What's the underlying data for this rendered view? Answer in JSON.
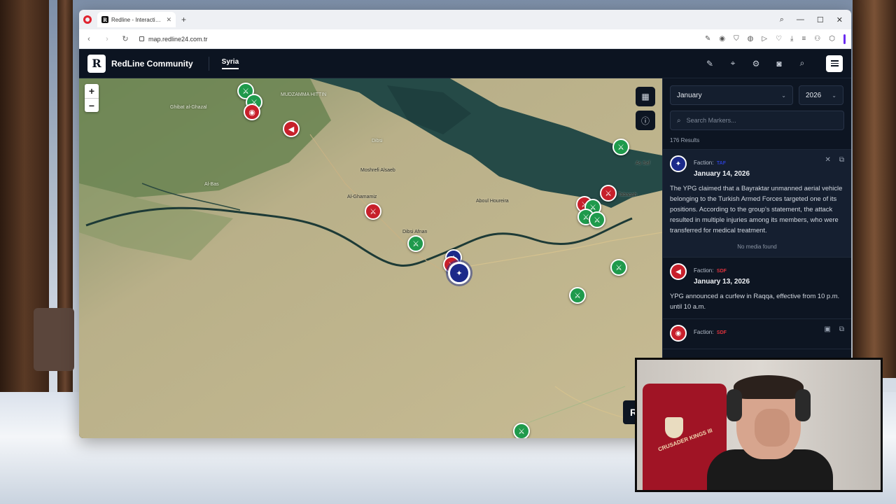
{
  "browser": {
    "tab_title": "Redline - Interactive Strat",
    "tab_favicon": "R",
    "url": "map.redline24.com.tr"
  },
  "app": {
    "logo_letter": "R",
    "title": "RedLine Community",
    "region_tab": "Syria",
    "header_icons": [
      "pen-icon",
      "location-pin-icon",
      "gear-icon",
      "camera-icon",
      "search-icon",
      "menu-icon"
    ]
  },
  "map": {
    "zoom_in": "+",
    "zoom_out": "−",
    "labels": [
      {
        "text": "Dibsi"
      },
      {
        "text": "Moshrefi Alsaeb"
      },
      {
        "text": "Al-Ghamamiz"
      },
      {
        "text": "Dibsi Afnan"
      },
      {
        "text": "Aboul Houreira"
      },
      {
        "text": "Al-Bas"
      },
      {
        "text": "Ghibat al-Ghazal"
      },
      {
        "text": "MUDZAMMA HITTIN"
      },
      {
        "text": "Tabaqah"
      },
      {
        "text": "As Saf"
      }
    ],
    "badge_letter": "R"
  },
  "panel": {
    "month": "January",
    "year": "2026",
    "search_placeholder": "Search Markers...",
    "results_count": "176 Results",
    "entries": [
      {
        "faction_label": "Faction:",
        "faction": "TAF",
        "date": "January 14, 2026",
        "body": "The YPG claimed that a Bayraktar unmanned aerial vehicle belonging to the Turkish Armed Forces targeted one of its positions. According to the group's statement, the attack resulted in multiple injuries among its members, who were transferred for medical treatment.",
        "media": "No media found"
      },
      {
        "faction_label": "Faction:",
        "faction": "SDF",
        "date": "January 13, 2026",
        "body": "YPG announced a curfew in Raqqa, effective from 10 p.m. until 10 a.m."
      },
      {
        "faction_label": "Faction:",
        "faction": "SDF"
      }
    ]
  },
  "webcam": {
    "chair_text": "CRUSADER KINGS III"
  },
  "colors": {
    "accent_red": "#c7202b",
    "accent_green": "#1f9a4c",
    "accent_blue": "#1c2a8a",
    "panel_bg": "#0d1522"
  }
}
